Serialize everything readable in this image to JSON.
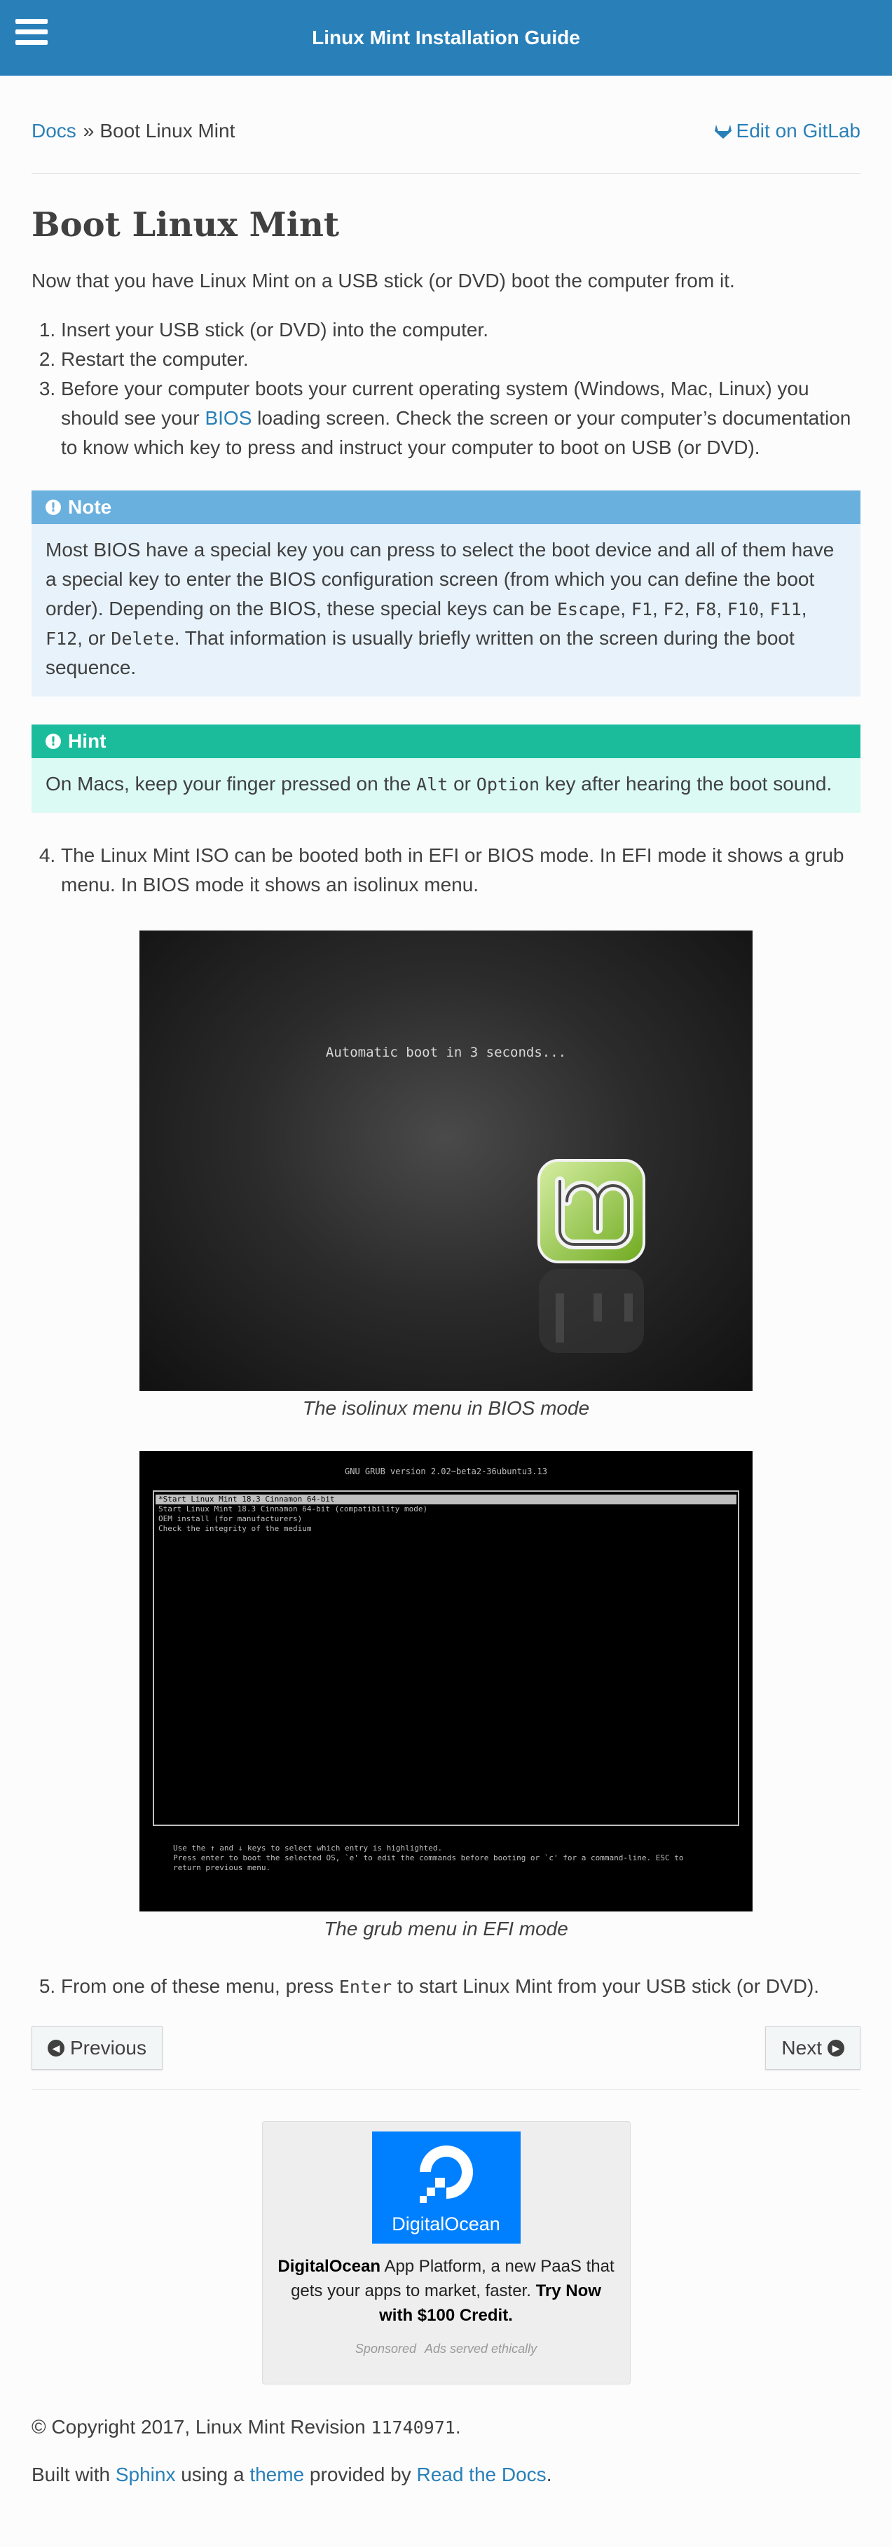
{
  "header": {
    "title": "Linux Mint Installation Guide",
    "menu_icon": "hamburger-icon"
  },
  "breadcrumb": {
    "root": "Docs",
    "separator": "»",
    "current": "Boot Linux Mint",
    "edit_label": "Edit on GitLab",
    "edit_icon": "gitlab-icon"
  },
  "page": {
    "title": "Boot Linux Mint",
    "intro": "Now that you have Linux Mint on a USB stick (or DVD) boot the computer from it.",
    "steps": {
      "s1": "Insert your USB stick (or DVD) into the computer.",
      "s2": "Restart the computer.",
      "s3_before": "Before your computer boots your current operating system (Windows, Mac, Linux) you should see your ",
      "s3_link": "BIOS",
      "s3_after": " loading screen. Check the screen or your computer’s documentation to know which key to press and instruct your computer to boot on USB (or DVD).",
      "s4": "The Linux Mint ISO can be booted both in EFI or BIOS mode. In EFI mode it shows a grub menu. In BIOS mode it shows an isolinux menu.",
      "s5_before": "From one of these menu, press ",
      "s5_code": "Enter",
      "s5_after": " to start Linux Mint from your USB stick (or DVD)."
    }
  },
  "note": {
    "title": "Note",
    "text1": "Most BIOS have a special key you can press to select the boot device and all of them have a special key to enter the BIOS configuration screen (from which you can define the boot order). Depending on the BIOS, these special keys can be ",
    "keys": [
      "Escape",
      "F1",
      "F2",
      "F8",
      "F10",
      "F11",
      "F12",
      "Delete"
    ],
    "text2": ". That information is usually briefly written on the screen during the boot sequence."
  },
  "hint": {
    "title": "Hint",
    "text1": "On Macs, keep your finger pressed on the ",
    "key1": "Alt",
    "text_or": " or ",
    "key2": "Option",
    "text2": " key after hearing the boot sound."
  },
  "figures": {
    "isolinux": {
      "screen_text": "Automatic boot in 3 seconds...",
      "caption": "The isolinux menu in BIOS mode"
    },
    "grub": {
      "header": "GNU GRUB  version 2.02~beta2-36ubuntu3.13",
      "entries": [
        "*Start Linux Mint 18.3 Cinnamon 64-bit",
        " Start Linux Mint 18.3 Cinnamon 64-bit (compatibility mode)",
        " OEM install (for manufacturers)",
        " Check the integrity of the medium"
      ],
      "footer": "Use the ↑ and ↓ keys to select which entry is highlighted.\nPress enter to boot the selected OS, `e' to edit the commands before booting or `c' for a command-line. ESC to\nreturn previous menu.",
      "caption": "The grub menu in EFI mode"
    }
  },
  "nav": {
    "previous": "Previous",
    "next": "Next",
    "previous_icon": "arrow-circle-left-icon",
    "next_icon": "arrow-circle-right-icon"
  },
  "ad": {
    "brand": "DigitalOcean",
    "text_before": " App Platform, a new PaaS that gets your apps to market, faster. ",
    "cta": "Try Now with $100 Credit.",
    "sponsored": "Sponsored",
    "ethical": "Ads served ethically"
  },
  "footer": {
    "copyright": "© Copyright 2017, Linux Mint Revision ",
    "revision": "11740971",
    "copyright_end": ".",
    "built_with": "Built with ",
    "sphinx": "Sphinx",
    "using_a": " using a ",
    "theme": "theme",
    "provided_by": " provided by ",
    "rtd": "Read the Docs",
    "end": "."
  },
  "colors": {
    "header_bg": "#2980b9",
    "link": "#2980b9",
    "note_title": "#6ab0de",
    "note_bg": "#e7f2fa",
    "hint_title": "#1abc9c",
    "hint_bg": "#dbfaf4",
    "ad_brand": "#0080ff"
  }
}
